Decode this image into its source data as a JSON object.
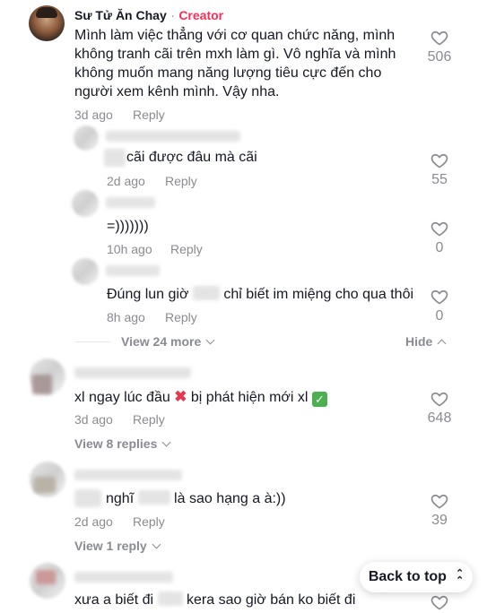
{
  "comments": {
    "main": {
      "username": "Sư Tử Ăn Chay",
      "separator": "·",
      "badge": "Creator",
      "text_lines": [
        "Mình làm việc thẳng với cơ quan chức năng, mình",
        "không tranh cãi trên mxh làm gì. Vô nghĩa và mình",
        "không muốn mang năng lượng tiêu cực đến cho",
        "người xem kênh mình. Vậy nha."
      ],
      "time": "3d ago",
      "reply_label": "Reply",
      "likes": "506"
    },
    "replies": [
      {
        "text": "cãi được đâu mà cãi",
        "time": "2d ago",
        "reply_label": "Reply",
        "likes": "55"
      },
      {
        "text": "=)))))))",
        "time": "10h ago",
        "reply_label": "Reply",
        "likes": "0"
      },
      {
        "text_before": "Đúng lun giờ",
        "text_after": "chỉ biết im miệng cho qua thôi",
        "time": "8h ago",
        "reply_label": "Reply",
        "likes": "0"
      }
    ],
    "thread_controls": {
      "view_more": "View 24 more",
      "hide": "Hide"
    },
    "comment2": {
      "text_before": "xl ngay lúc đầu",
      "text_middle": "bị phát hiện mới xl",
      "time": "3d ago",
      "reply_label": "Reply",
      "likes": "648",
      "view_replies": "View 8 replies"
    },
    "comment3": {
      "text_a": "nghĩ",
      "text_b": "là sao hạng a à:))",
      "time": "2d ago",
      "reply_label": "Reply",
      "likes": "39",
      "view_replies": "View 1 reply"
    },
    "comment4": {
      "text_a": "xưa a biết đi",
      "text_b": "kera sao giờ bán ko biết đi"
    }
  },
  "back_to_top": "Back to top",
  "colors": {
    "creator": "#fe2c55",
    "muted": "#8a8b91",
    "text": "#161823"
  },
  "icons": [
    "heart-icon",
    "chevron-down-icon",
    "chevron-up-icon",
    "cross-mark-icon",
    "check-mark-icon",
    "double-chevron-up-icon"
  ]
}
